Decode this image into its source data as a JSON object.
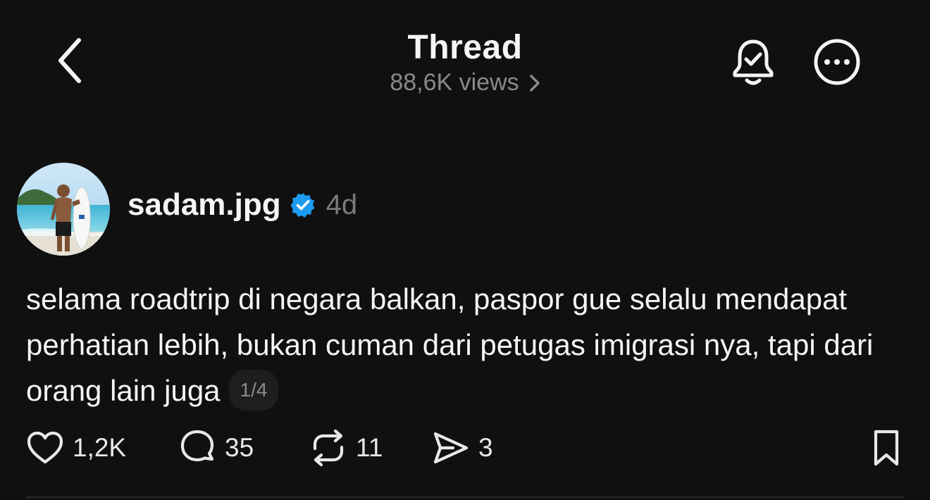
{
  "header": {
    "title": "Thread",
    "views": "88,6K views",
    "back_icon": "chevron-left-icon",
    "views_chevron_icon": "chevron-right-icon",
    "notify_icon": "bell-check-icon",
    "more_icon": "more-circle-icon"
  },
  "post": {
    "username": "sadam.jpg",
    "verified_icon": "verified-badge-icon",
    "verified_color": "#1d9bf0",
    "time": "4d",
    "text": "selama roadtrip di negara balkan, paspor gue selalu mendapat perhatian lebih, bukan cuman dari petugas imigrasi nya, tapi dari orang lain juga",
    "pager": "1/4",
    "avatar_icon": "avatar-photo"
  },
  "actions": {
    "likes": "1,2K",
    "replies": "35",
    "reposts": "11",
    "shares": "3",
    "like_icon": "heart-icon",
    "reply_icon": "comment-icon",
    "repost_icon": "repost-icon",
    "share_icon": "send-icon",
    "bookmark_icon": "bookmark-icon"
  },
  "colors": {
    "background": "#101010",
    "text": "#f3f5f7",
    "muted": "#8a8a8a"
  }
}
